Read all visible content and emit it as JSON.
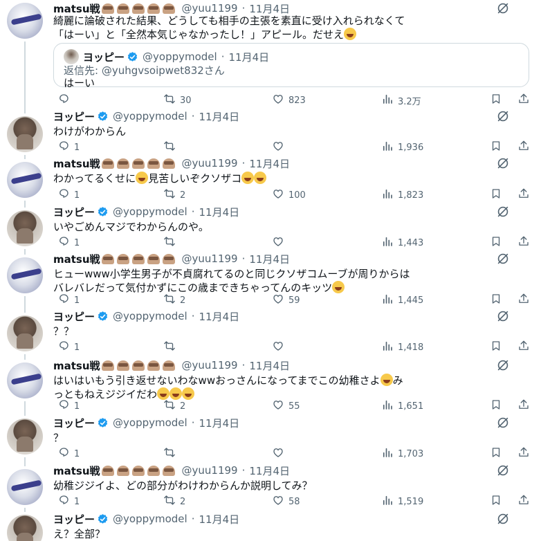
{
  "tweets": [
    {
      "author": "matsu戦",
      "handle": "@yuu1199",
      "date": "11月4日",
      "text_lines": [
        "綺麗に論破された結果、どうしても相手の主張を素直に受け入れられなくて",
        "「はーい」と「全然本気じゃなかったし！」アピール。だせえ😏"
      ],
      "quote": {
        "author": "ヨッピー",
        "handle": "@yoppymodel",
        "date": "11月4日",
        "reply_to": "返信先: @yuhgvsoipwet832さん",
        "text": "はーい"
      },
      "replies": "",
      "reposts": "30",
      "likes": "823",
      "views": "3.2万"
    },
    {
      "author": "ヨッピー",
      "handle": "@yoppymodel",
      "date": "11月4日",
      "text_lines": [
        "わけがわからん"
      ],
      "replies": "1",
      "reposts": "",
      "likes": "",
      "views": "1,936"
    },
    {
      "author": "matsu戦",
      "handle": "@yuu1199",
      "date": "11月4日",
      "text_lines": [
        "わかってるくせに😂見苦しいぞクソザコ😂😂"
      ],
      "replies": "1",
      "reposts": "2",
      "likes": "100",
      "views": "1,823"
    },
    {
      "author": "ヨッピー",
      "handle": "@yoppymodel",
      "date": "11月4日",
      "text_lines": [
        "いやごめんマジでわからんのや。"
      ],
      "replies": "1",
      "reposts": "",
      "likes": "",
      "views": "1,443"
    },
    {
      "author": "matsu戦",
      "handle": "@yuu1199",
      "date": "11月4日",
      "text_lines": [
        "ヒューwww小学生男子が不貞腐れてるのと同じクソザコムーブが周りからは",
        "バレバレだって気付かずにこの歳まできちゃってんのキッツ😂"
      ],
      "replies": "1",
      "reposts": "2",
      "likes": "59",
      "views": "1,445"
    },
    {
      "author": "ヨッピー",
      "handle": "@yoppymodel",
      "date": "11月4日",
      "text_lines": [
        "？？"
      ],
      "replies": "1",
      "reposts": "",
      "likes": "",
      "views": "1,418"
    },
    {
      "author": "matsu戦",
      "handle": "@yuu1199",
      "date": "11月4日",
      "text_lines": [
        "はいはいもう引き返せないわなwwおっさんになってまでこの幼稚さよ😅み",
        "っともねえジジイだわ😂😂😂"
      ],
      "replies": "1",
      "reposts": "2",
      "likes": "55",
      "views": "1,651"
    },
    {
      "author": "ヨッピー",
      "handle": "@yoppymodel",
      "date": "11月4日",
      "text_lines": [
        "？"
      ],
      "replies": "1",
      "reposts": "",
      "likes": "",
      "views": "1,703"
    },
    {
      "author": "matsu戦",
      "handle": "@yuu1199",
      "date": "11月4日",
      "text_lines": [
        "幼稚ジジイよ、どの部分がわけわからんか説明してみ？"
      ],
      "replies": "1",
      "reposts": "2",
      "likes": "58",
      "views": "1,519"
    },
    {
      "author": "ヨッピー",
      "handle": "@yoppymodel",
      "date": "11月4日",
      "text_lines": [
        "え？全部？"
      ],
      "replies": "",
      "reposts": "",
      "likes": "",
      "views": ""
    }
  ],
  "colors": {
    "verified": "#1d9bf0",
    "muted": "#536471",
    "text": "#0f1419",
    "border": "#cfd9de"
  },
  "icons": [
    "reply-icon",
    "repost-icon",
    "like-icon",
    "views-icon",
    "bookmark-icon",
    "share-icon",
    "grok-icon",
    "verified-icon"
  ]
}
